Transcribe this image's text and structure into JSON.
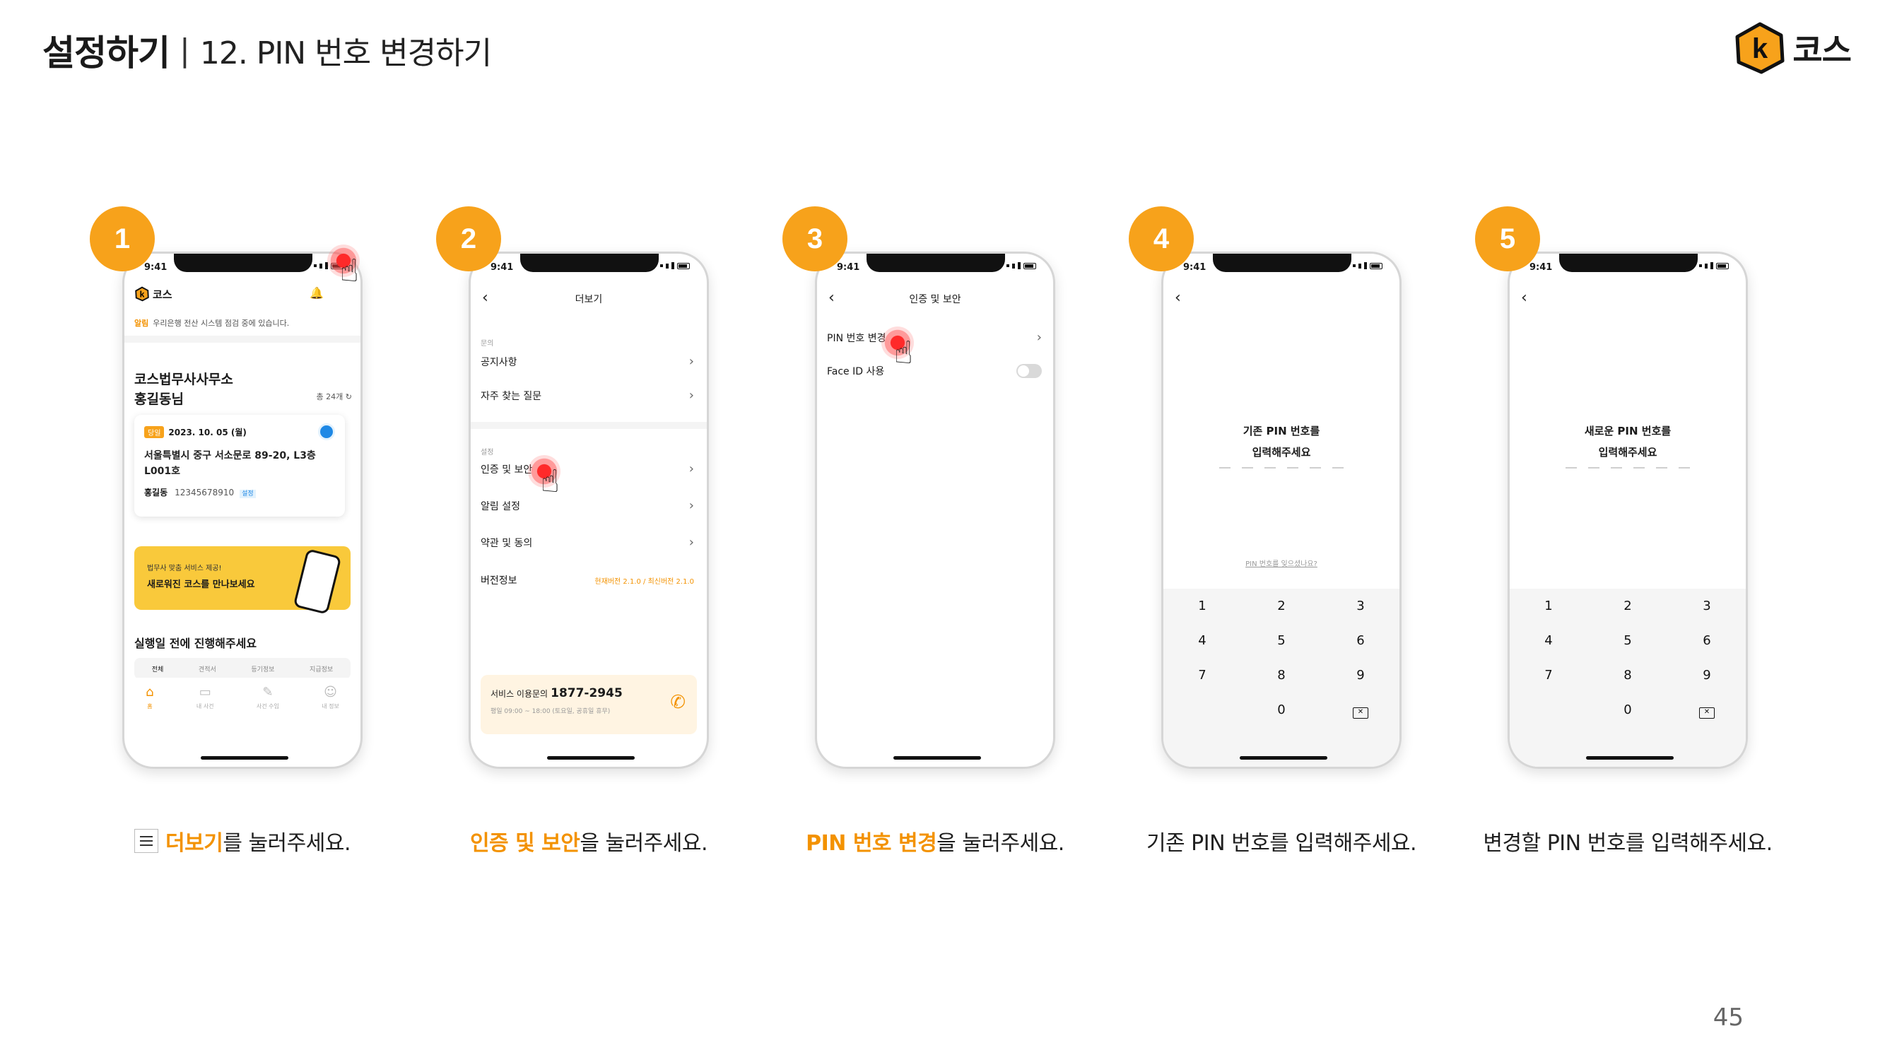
{
  "header": {
    "title_main": "설정하기",
    "title_sep": "|",
    "title_sub": "12. PIN 번호 변경하기",
    "brand_name": "코스",
    "brand_letter": "k"
  },
  "page_number": "45",
  "statusbar_time": "9:41",
  "colors": {
    "accent": "#f39200",
    "badge": "#f7a21b",
    "banner": "#f9c93b"
  },
  "steps": [
    {
      "number": "1",
      "caption_hl": "더보기",
      "caption_rest": "를 눌러주세요."
    },
    {
      "number": "2",
      "caption_hl": "인증 및 보안",
      "caption_rest": "을 눌러주세요."
    },
    {
      "number": "3",
      "caption_hl": "PIN 번호 변경",
      "caption_rest": "을 눌러주세요."
    },
    {
      "number": "4",
      "caption_hl": "",
      "caption_rest": "기존 PIN 번호를 입력해주세요."
    },
    {
      "number": "5",
      "caption_hl": "",
      "caption_rest": "변경할 PIN 번호를 입력해주세요."
    }
  ],
  "phone1": {
    "logo": "코스",
    "notice_tag": "알림",
    "notice_text": "우리은행 전산 시스템 점검 중에 있습니다.",
    "office": "코스법무사사무소",
    "user": "홍길동님",
    "total": "총 24개",
    "card_tag": "당일",
    "card_date": "2023. 10. 05 (월)",
    "card_addr_1": "서울특별시 중구 서소문로 89-20, L3층",
    "card_addr_2": "L001호",
    "card_name": "홍길동",
    "card_phone": "12345678910",
    "card_badge": "설정",
    "banner_small": "법무사 맞춤 서비스 제공!",
    "banner_big": "새로워진 코스를 만나보세요",
    "section_title": "실행일 전에 진행해주세요",
    "filters": [
      "전체",
      "견적서",
      "등기정보",
      "지급정보"
    ],
    "tabs": [
      "홈",
      "내 사건",
      "사건 수임",
      "내 정보"
    ]
  },
  "phone2": {
    "nav_title": "더보기",
    "cat_1": "문의",
    "item_notice": "공지사항",
    "item_faq": "자주 찾는 질문",
    "cat_2": "설정",
    "item_security": "인증 및 보안",
    "item_alarm": "알림 설정",
    "item_terms": "약관 및 동의",
    "item_version": "버전정보",
    "version_value": "현재버전 2.1.0 / 최신버전 2.1.0",
    "call_label": "서비스 이용문의",
    "call_number": "1877-2945",
    "call_hours": "평일 09:00 ~ 18:00 (토요일, 공휴일 휴무)"
  },
  "phone3": {
    "nav_title": "인증 및 보안",
    "item_pin": "PIN 번호 변경",
    "item_faceid": "Face ID 사용"
  },
  "phone4": {
    "prompt_1": "기존 PIN 번호를",
    "prompt_2": "입력해주세요",
    "forgot": "PIN 번호를 잊으셨나요?"
  },
  "phone5": {
    "prompt_1": "새로운 PIN 번호를",
    "prompt_2": "입력해주세요"
  },
  "keypad": [
    "1",
    "2",
    "3",
    "4",
    "5",
    "6",
    "7",
    "8",
    "9",
    "0"
  ]
}
